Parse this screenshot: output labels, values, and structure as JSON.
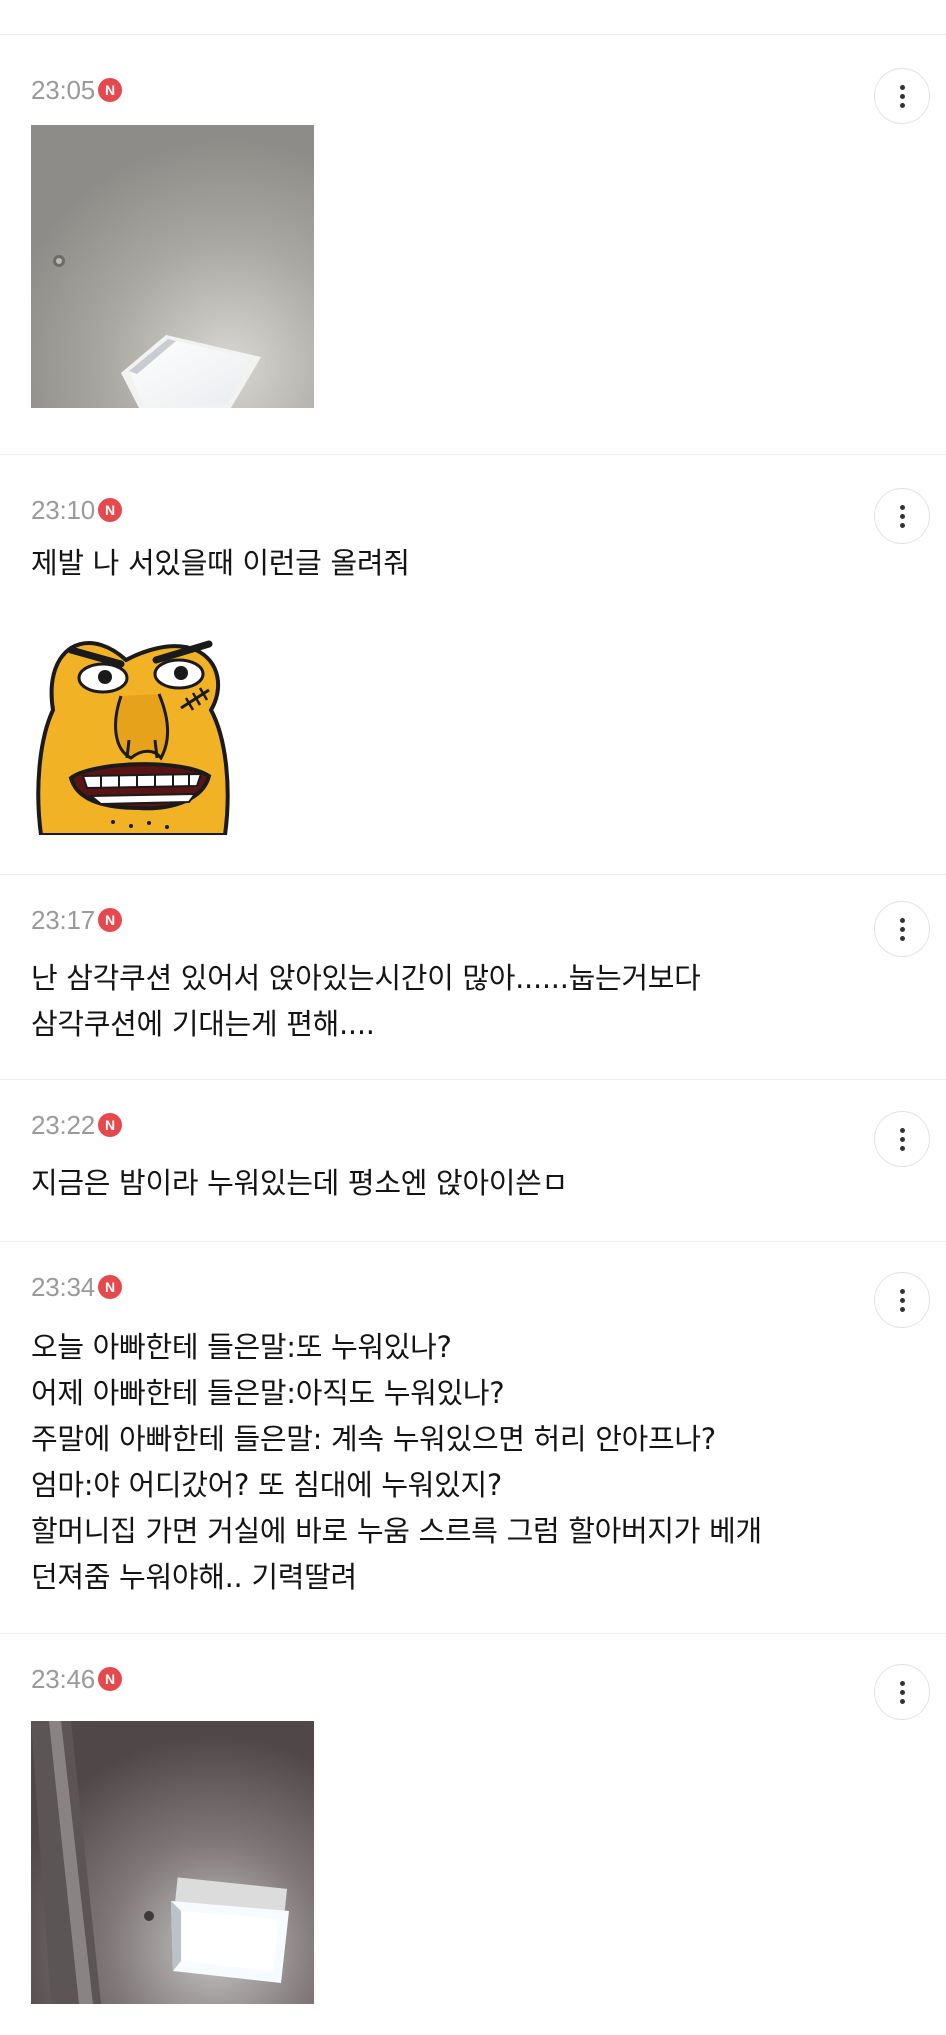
{
  "posts": [
    {
      "time": "23:05",
      "badge": "N",
      "kind": "photo",
      "photo_desc": "ceiling-light-photo"
    },
    {
      "time": "23:10",
      "badge": "N",
      "kind": "text-sticker",
      "text": "제발 나 서있을때 이런글 올려줘"
    },
    {
      "time": "23:17",
      "badge": "N",
      "kind": "text",
      "text": "난 삼각쿠션 있어서 앉아있는시간이 많아......눕는거보다\n삼각쿠션에 기대는게 편해...."
    },
    {
      "time": "23:22",
      "badge": "N",
      "kind": "text",
      "text": "지금은 밤이라 누워있는데 평소엔 앉아이쓴ㅁ"
    },
    {
      "time": "23:34",
      "badge": "N",
      "kind": "text",
      "text": "오늘 아빠한테 들은말:또 누워있나?\n어제 아빠한테 들은말:아직도 누워있나?\n주말에 아빠한테 들은말: 계속 누워있으면 허리 안아프나?\n엄마:야 어디갔어? 또 침대에 누워있지?\n할머니집 가면 거실에 바로 누움 스르륵 그럼 할아버지가 베개\n던져줌 누워야해.. 기력딸려"
    },
    {
      "time": "23:46",
      "badge": "N",
      "kind": "photo",
      "photo_desc": "ceiling-light-photo-2"
    }
  ],
  "icons": {
    "more": "more-vertical-icon",
    "new": "new-badge-icon"
  },
  "colors": {
    "badge": "#e5484d",
    "time": "#9a9a9a",
    "text": "#141414",
    "divider": "#ececec"
  }
}
